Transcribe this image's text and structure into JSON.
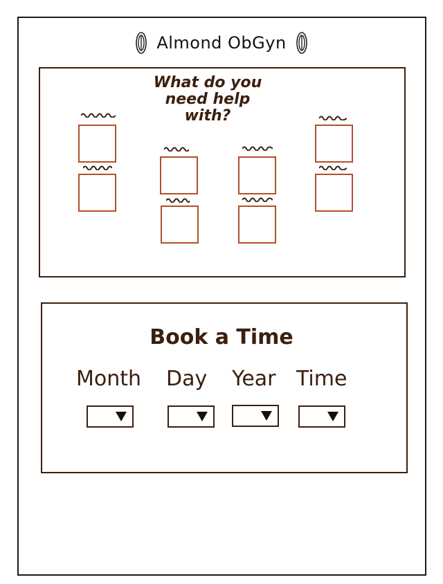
{
  "header": {
    "brand": "Almond ObGyn"
  },
  "help": {
    "title": "What do you need help with?"
  },
  "booking": {
    "title": "Book a Time",
    "fields": [
      {
        "label": "Month"
      },
      {
        "label": "Day"
      },
      {
        "label": "Year"
      },
      {
        "label": "Time"
      }
    ]
  },
  "colors": {
    "ink": "#3b1f0e",
    "option_border": "#b24f2a"
  },
  "icons": {
    "logo": "almond-icon",
    "dropdown": "dropdown-arrow-icon"
  }
}
